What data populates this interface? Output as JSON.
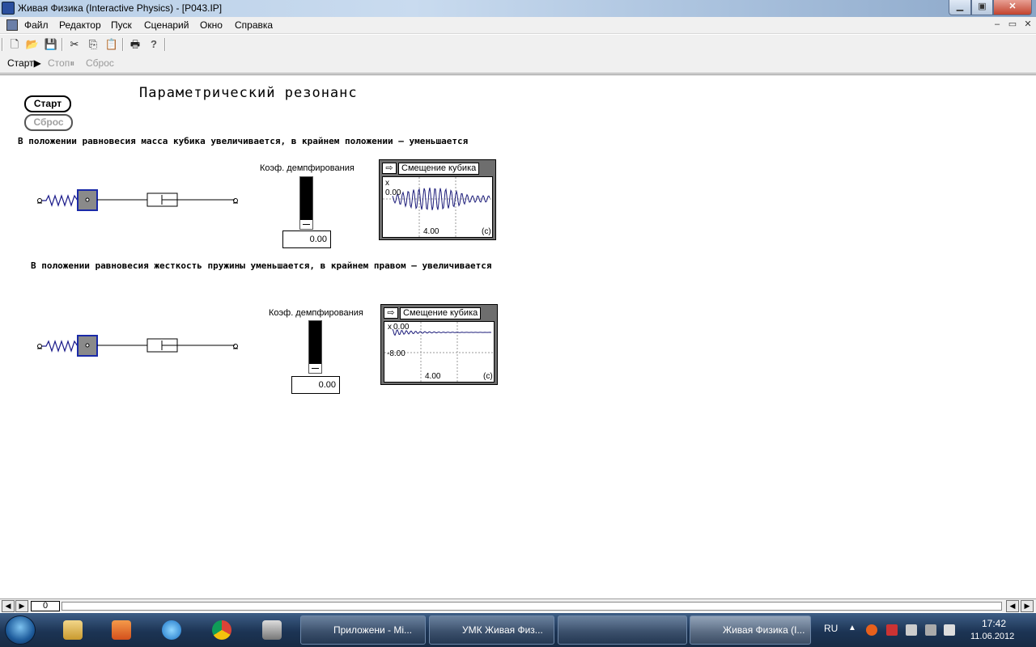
{
  "window": {
    "title": "Живая Физика (Interactive Physics) - [P043.IP]",
    "min_glyph": "▁",
    "max_glyph": "▣",
    "close_glyph": "✕"
  },
  "menu": {
    "items": [
      "Файл",
      "Редактор",
      "Пуск",
      "Сценарий",
      "Окно",
      "Справка"
    ],
    "mdi_min": "–",
    "mdi_restore": "▭",
    "mdi_close": "✕"
  },
  "toolbar": {
    "icons": [
      "new-file-icon",
      "open-folder-icon",
      "save-icon",
      "cut-icon",
      "copy-icon",
      "paste-icon",
      "print-icon",
      "help-icon"
    ],
    "glyphs": [
      "🗋",
      "📂",
      "💾",
      "✂",
      "⎘",
      "📋",
      "🖶",
      "?"
    ]
  },
  "control": {
    "start": "Старт▶",
    "stop": "Стоп⏸",
    "reset": "Сброс"
  },
  "sim": {
    "title": "Параметрический резонанс",
    "start_button": "Старт",
    "reset_button": "Сброс",
    "section1": {
      "description": "В положении равновесия масса кубика увеличивается, в крайнем положении — уменьшается",
      "slider_label": "Коэф. демпфирования",
      "slider_value": "0.00",
      "slider_level": 0,
      "graph": {
        "title": "Смещение кубика",
        "y_label": "x",
        "y_tick": "0.00",
        "x_tick": "4.00",
        "x_unit": "(c)"
      }
    },
    "section2": {
      "description": "В положении равновесия жесткость пружины уменьшается, в крайнем правом — увеличивается",
      "slider_label": "Коэф. демпфирования",
      "slider_value": "0.00",
      "slider_level": 0,
      "graph": {
        "title": "Смещение кубика",
        "y_label": "x",
        "y_tick_top": "0.00",
        "y_tick_bottom": "-8.00",
        "x_tick": "4.00",
        "x_unit": "(c)"
      }
    }
  },
  "scrollbar": {
    "frame": "0"
  },
  "taskbar": {
    "tasks": [
      {
        "label": "Приложени - Mi..."
      },
      {
        "label": "УМК Живая Физ..."
      },
      {
        "label": ""
      },
      {
        "label": "Живая Физика (I..."
      }
    ],
    "lang": "RU",
    "time": "17:42",
    "date": "11.06.2012"
  }
}
